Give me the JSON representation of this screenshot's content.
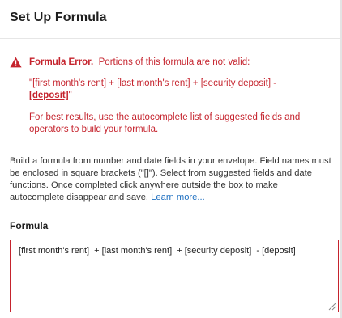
{
  "dialog": {
    "title": "Set Up Formula"
  },
  "error": {
    "icon": "warning-triangle-icon",
    "color": "#c5232d",
    "heading": "Formula Error.",
    "message": "Portions of this formula are not valid:",
    "formula_valid_part": "\"[first month's rent] + [last month's rent] + [security deposit] - ",
    "formula_invalid_part": "[deposit]",
    "formula_end": "\"",
    "hint": "For best results, use the autocomplete list of suggested fields and operators to build your formula."
  },
  "description": {
    "text": "Build a formula from number and date fields in your envelope. Field names must be enclosed in square brackets (\"[]\"). Select from suggested fields and date functions. Once completed click anywhere outside the box to make autocomplete disappear and save.",
    "link": "Learn more...",
    "link_color": "#1f70c1"
  },
  "formula_field": {
    "label": "Formula",
    "value": "[first month's rent]  + [last month's rent]  + [security deposit]  - [deposit]"
  }
}
